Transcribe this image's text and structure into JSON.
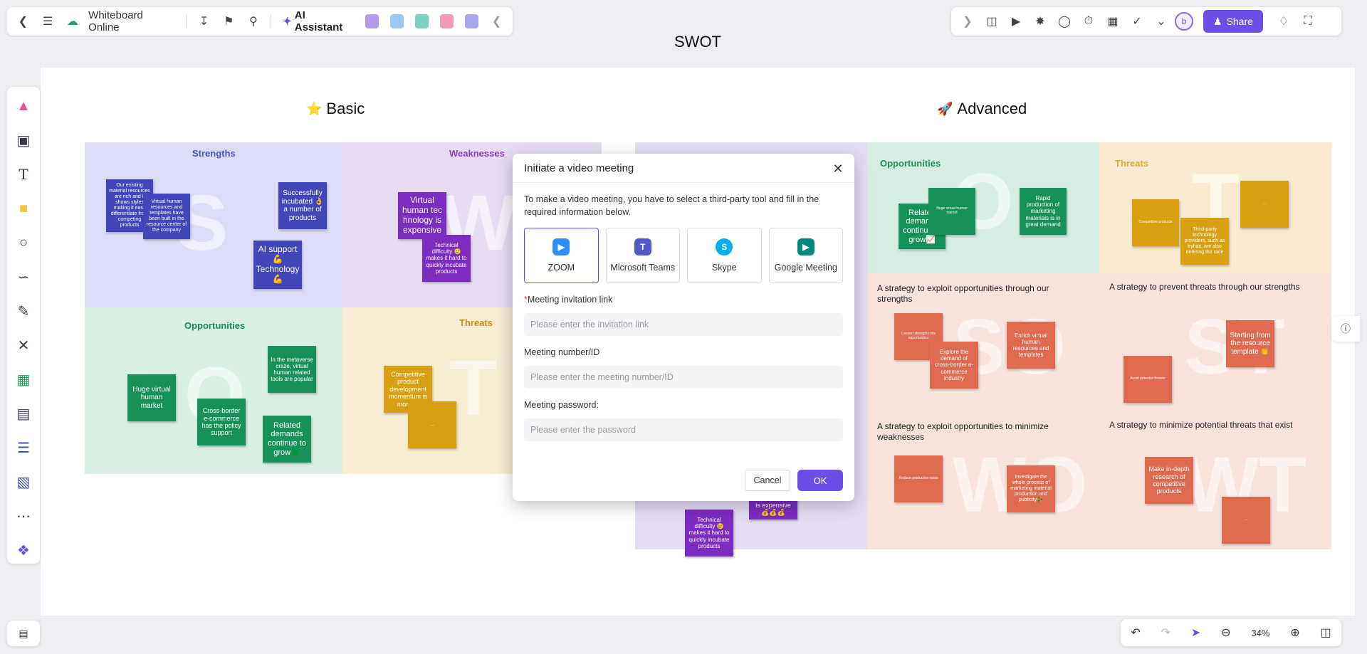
{
  "app": {
    "title": "Whiteboard Online",
    "ai_assistant": "AI Assistant",
    "share": "Share",
    "avatar_letter": "b",
    "zoom": "34%"
  },
  "board": {
    "title": "SWOT",
    "basic_title": "Basic",
    "advanced_title": "Advanced",
    "basic": {
      "strengths": "Strengths",
      "weaknesses": "Weaknesses",
      "opportunities": "Opportunities",
      "threats": "Threats",
      "strengths_notes": [
        "Our existing material resources are rich and it shows styles making it easy differentiate from competing products",
        "Virtual human resources and templates have been built in the resource center of the company",
        "Successfully incubated 👌 a number of products",
        "AI support 💪 Technology💪"
      ],
      "weakness_notes": [
        "Virtual human tec hnology is expensive",
        "Technical difficulty 😢 makes it hard to quickly incubate products"
      ],
      "opportunity_notes": [
        "Huge virtual human market",
        "Cross-border e-commerce has the policy support",
        "In the metaverse craze, virtual human related tools are popular",
        "Related demands continue to grow🌲"
      ],
      "threat_notes": [
        "Competitive product development momentum is more ...",
        "..."
      ]
    },
    "advanced": {
      "opportunities": "Opportunities",
      "threats": "Threats",
      "so_text": "A strategy to exploit opportunities through our strengths",
      "st_text": "A strategy to prevent threats through our strengths",
      "wo_text": "A strategy to exploit opportunities to minimize weaknesses",
      "wt_text": "A strategy to minimize potential threats that exist",
      "opportunity_notes": [
        "Related demands continue to grow📈",
        "Huge virtual human market",
        "Rapid production of marketing materials is in great demand"
      ],
      "threat_notes": [
        "Competitive products",
        "Third-party technology providers, such as tryhas, are also entering the race",
        "..."
      ],
      "so_notes": [
        "Convert strengths into opportunities",
        "Explore the demand of cross-border e-commerce industry",
        "Enrich virtual human resources and templates"
      ],
      "st_notes": [
        "Starting from the resource template 👏",
        "Avoid potential threats"
      ],
      "wo_notes": [
        "Reduce production costs",
        "Investigate the whole process of marketing material production and publicity♻️"
      ],
      "wt_notes": [
        "Make in-depth research of competitive products",
        "..."
      ],
      "w_notes": [
        "Technical difficulty 😢 makes it hard to quickly incubate products",
        "is expensive 💰💰💰"
      ]
    }
  },
  "modal": {
    "title": "Initiate a video meeting",
    "description": "To make a video meeting, you have to select a third-party tool and fill in the required information below.",
    "tools": [
      {
        "label": "ZOOM",
        "icon": "zoom-icon",
        "color": "#2d8cff"
      },
      {
        "label": "Microsoft Teams",
        "icon": "teams-icon",
        "color": "#5059c9"
      },
      {
        "label": "Skype",
        "icon": "skype-icon",
        "color": "#00aff0"
      },
      {
        "label": "Google Meeting",
        "icon": "google-meet-icon",
        "color": "#00897b"
      }
    ],
    "link_label": "Meeting invitation link",
    "link_required_mark": "*",
    "link_placeholder": "Please enter the invitation link",
    "number_label": "Meeting number/ID",
    "number_placeholder": "Please enter the meeting number/ID",
    "password_label": "Meeting password:",
    "password_placeholder": "Please enter the password",
    "cancel": "Cancel",
    "ok": "OK"
  },
  "colors": {
    "accent": "#6d4ee6",
    "basic_strengths_bg": "#dcdcf6",
    "basic_weaknesses_bg": "#e7dcf2",
    "basic_opportunities_bg": "#d9efe3",
    "basic_threats_bg": "#f6ecd2",
    "adv_opportunities_bg": "#d6ede4",
    "adv_threats_bg": "#f7ead0",
    "adv_strategy_bg": "#f8e3dc"
  }
}
